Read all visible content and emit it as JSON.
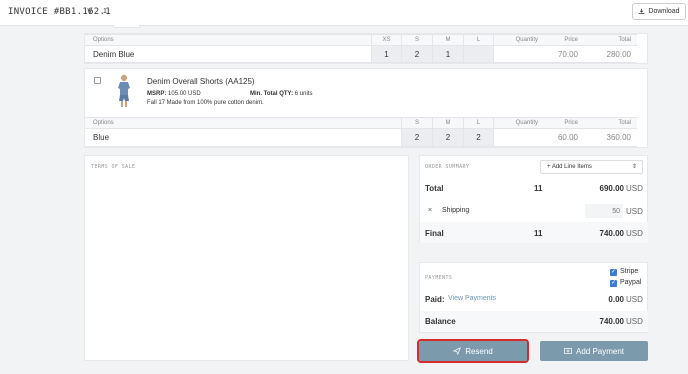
{
  "header": {
    "invoice_title": "INVOICE #BB1.162.1",
    "count": "1",
    "download_label": "Download"
  },
  "table1": {
    "headers": {
      "options": "Options",
      "sizes": [
        "XS",
        "S",
        "M",
        "L"
      ],
      "quantity": "Quantity",
      "price": "Price",
      "total": "Total"
    },
    "row": {
      "label": "Denim Blue",
      "sizes": [
        "1",
        "2",
        "1",
        ""
      ],
      "quantity": "",
      "price": "70.00",
      "total": "280.00"
    }
  },
  "product": {
    "name": "Denim Overall Shorts (AA125)",
    "msrp_label": "MSRP:",
    "msrp_value": "105.00 USD",
    "min_label": "Min. Total QTY:",
    "min_value": "6 units",
    "description": "Fall 17 Made from 100% pure cotton denim."
  },
  "table2": {
    "headers": {
      "options": "Options",
      "sizes": [
        "S",
        "M",
        "L"
      ],
      "quantity": "Quantity",
      "price": "Price",
      "total": "Total"
    },
    "row": {
      "label": "Blue",
      "sizes": [
        "2",
        "2",
        "2"
      ],
      "quantity": "",
      "price": "60.00",
      "total": "360.00"
    }
  },
  "terms": {
    "title": "TERMS OF SALE"
  },
  "summary": {
    "title": "ORDER SUMMARY",
    "add_line_label": "+ Add Line Items",
    "total_label": "Total",
    "total_qty": "11",
    "total_value": "690.00",
    "shipping_label": "Shipping",
    "shipping_value": "50",
    "final_label": "Final",
    "final_qty": "11",
    "final_value": "740.00",
    "currency": "USD"
  },
  "payments": {
    "title": "PAYMENTS",
    "stripe_label": "Stripe",
    "paypal_label": "Paypal",
    "paid_label": "Paid:",
    "view_payments_label": "View Payments",
    "paid_value": "0.00",
    "balance_label": "Balance",
    "balance_value": "740.00",
    "currency": "USD"
  },
  "actions": {
    "resend_label": "Resend",
    "add_payment_label": "Add Payment"
  },
  "colors": {
    "accent_button": "#7b9aab",
    "highlight_outline": "#d62b2b",
    "checkbox": "#3b7bd4"
  }
}
